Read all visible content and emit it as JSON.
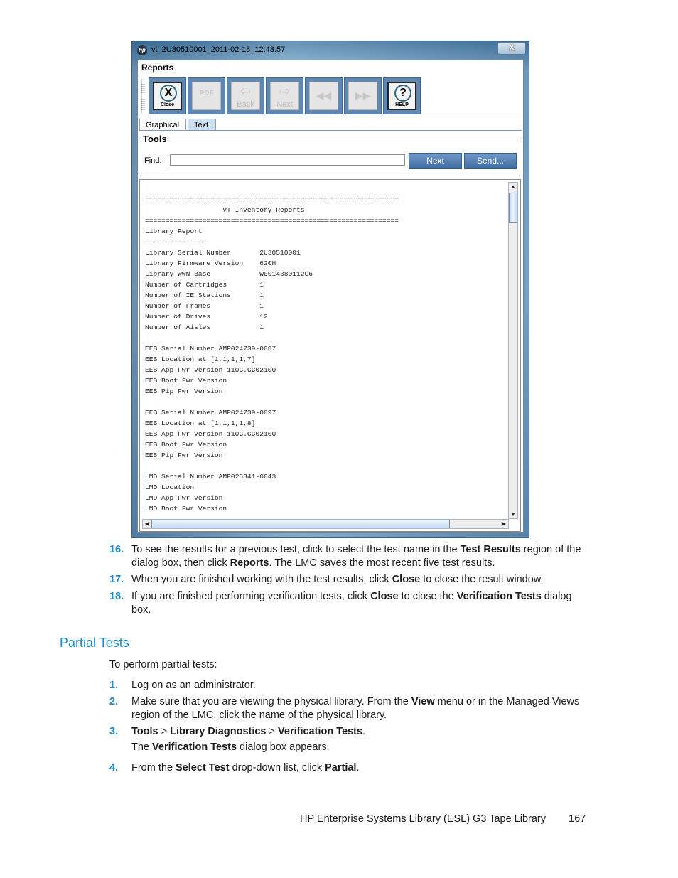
{
  "window": {
    "title": "vt_2U30510001_2011-02-18_12.43.57",
    "close_glyph": "X",
    "logo_text": "hp",
    "reports_label": "Reports",
    "toolbar": [
      {
        "id": "close",
        "label": "Close",
        "glyph": "X",
        "enabled": true
      },
      {
        "id": "pdf",
        "label": "",
        "glyph": "PDF",
        "enabled": false
      },
      {
        "id": "back",
        "label": "Back",
        "glyph": "⇦",
        "enabled": false
      },
      {
        "id": "next",
        "label": "Next",
        "glyph": "⇨",
        "enabled": false
      },
      {
        "id": "first",
        "label": "",
        "glyph": "◀◀",
        "enabled": false
      },
      {
        "id": "last",
        "label": "",
        "glyph": "▶▶",
        "enabled": false
      },
      {
        "id": "help",
        "label": "HELP",
        "glyph": "?",
        "enabled": true
      }
    ],
    "tabs": [
      {
        "label": "Graphical",
        "selected": false
      },
      {
        "label": "Text",
        "selected": true
      }
    ],
    "tools": {
      "legend": "Tools",
      "find_label": "Find:",
      "find_value": "",
      "next_button": "Next",
      "send_button": "Send..."
    },
    "report_lines": [
      "",
      "==============================================================",
      "                   VT Inventory Reports",
      "==============================================================",
      "Library Report",
      "---------------",
      "Library Serial Number       2U30510001",
      "Library Firmware Version    620H",
      "Library WWN Base            W0014380112C6",
      "Number of Cartridges        1",
      "Number of IE Stations       1",
      "Number of Frames            1",
      "Number of Drives            12",
      "Number of Aisles            1",
      "",
      "EEB Serial Number AMP024739-0087",
      "EEB Location at [1,1,1,1,7]",
      "EEB App Fwr Version 110G.GC02100",
      "EEB Boot Fwr Version",
      "EEB Pip Fwr Version",
      "",
      "EEB Serial Number AMP024739-0097",
      "EEB Location at [1,1,1,1,8]",
      "EEB App Fwr Version 110G.GC02100",
      "EEB Boot Fwr Version",
      "EEB Pip Fwr Version",
      "",
      "LMD Serial Number AMP025341-0043",
      "LMD Location",
      "LMD App Fwr Version",
      "LMD Boot Fwr Version"
    ],
    "scrollbar_glyphs": {
      "up": "▲",
      "down": "▼",
      "left": "◀",
      "right": "▶"
    }
  },
  "steps_top": [
    {
      "num": "16.",
      "html": "To see the results for a previous test, click to select the test name in the <b>Test Results</b> region of the dialog box, then click <b>Reports</b>. The LMC saves the most recent five test results."
    },
    {
      "num": "17.",
      "html": "When you are finished working with the test results, click <b>Close</b> to close the result window."
    },
    {
      "num": "18.",
      "html": "If you are finished performing verification tests, click <b>Close</b> to close the <b>Verification Tests</b> dialog box."
    }
  ],
  "section": {
    "title": "Partial Tests",
    "intro": "To perform partial tests:",
    "steps": [
      {
        "num": "1.",
        "html": "Log on as an administrator."
      },
      {
        "num": "2.",
        "html": "Make sure that you are viewing the physical library. From the <b>View</b> menu or in the Managed Views region of the LMC, click the name of the physical library."
      },
      {
        "num": "3.",
        "html": "<b>Tools</b> &gt; <b>Library Diagnostics</b> &gt; <b>Verification Tests</b>."
      },
      {
        "num": "4.",
        "html": "From the <b>Select Test</b> drop-down list, click <b>Partial</b>."
      }
    ],
    "step3_note_html": "The <b>Verification Tests</b> dialog box appears."
  },
  "footer": {
    "title": "HP Enterprise Systems Library (ESL) G3 Tape Library",
    "page": "167"
  }
}
